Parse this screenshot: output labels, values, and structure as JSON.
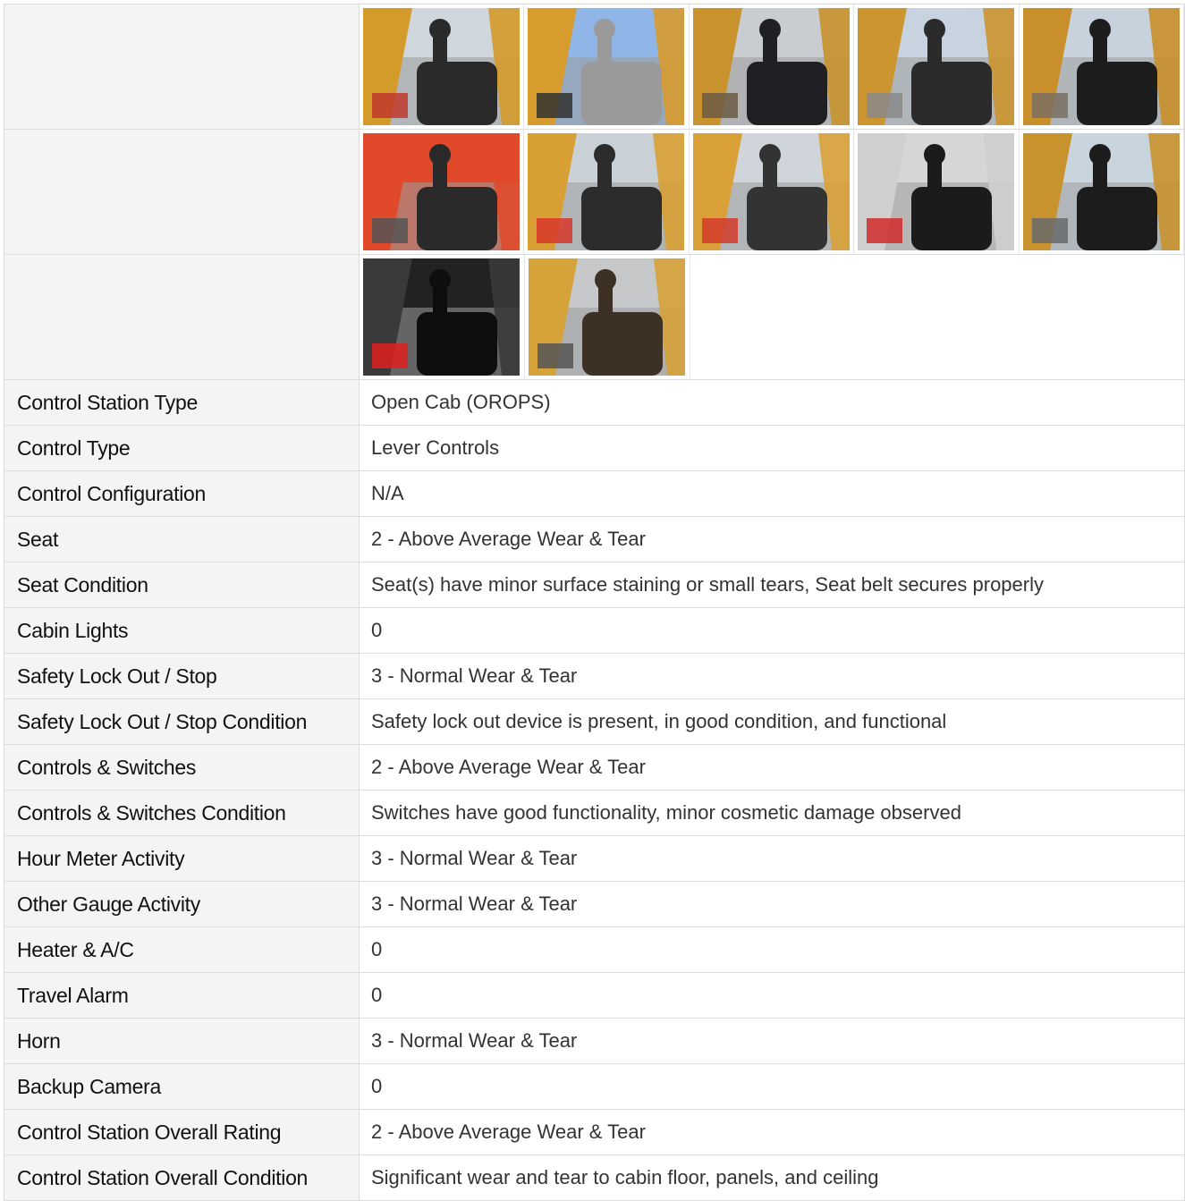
{
  "photos": [
    [
      {
        "name": "joystick-dash",
        "sky": "#cfd6dc",
        "body": "#d49a2a",
        "dark": "#2a2a2a",
        "accent": "#c0392b"
      },
      {
        "name": "cab-roof",
        "sky": "#8fb6e6",
        "body": "#d79b2e",
        "dark": "#9a9a9a",
        "accent": "#333333"
      },
      {
        "name": "seat-back",
        "sky": "#c9ccd0",
        "body": "#c9922c",
        "dark": "#1f1f24",
        "accent": "#6b5a44"
      },
      {
        "name": "seat-front",
        "sky": "#c7d3de",
        "body": "#cc9530",
        "dark": "#2b2b2b",
        "accent": "#8a8a8a"
      },
      {
        "name": "joystick-side",
        "sky": "#c8d2dc",
        "body": "#c98f2a",
        "dark": "#1d1d1d",
        "accent": "#7a6f60"
      }
    ],
    [
      {
        "name": "seat-cushion",
        "sky": "#e04a2a",
        "body": "#e04a2a",
        "dark": "#2a2a2a",
        "accent": "#555555"
      },
      {
        "name": "operator-area",
        "sky": "#c9d0d6",
        "body": "#d8a034",
        "dark": "#2c2c2c",
        "accent": "#d8372a"
      },
      {
        "name": "cab-side",
        "sky": "#cfd5da",
        "body": "#d9a137",
        "dark": "#333333",
        "accent": "#d33a2c"
      },
      {
        "name": "lever-closeup",
        "sky": "#d6d6d6",
        "body": "#cfcfcf",
        "dark": "#1b1b1b",
        "accent": "#d22a2a"
      },
      {
        "name": "joystick-rear",
        "sky": "#c9d5dd",
        "body": "#c8922d",
        "dark": "#1c1c1c",
        "accent": "#6a6a6a"
      }
    ],
    [
      {
        "name": "gauge-panel",
        "sky": "#222222",
        "body": "#3a3a3a",
        "dark": "#0e0e0e",
        "accent": "#e02020"
      },
      {
        "name": "panel-damage",
        "sky": "#c6c8ca",
        "body": "#d6a23a",
        "dark": "#3d3025",
        "accent": "#555555"
      }
    ]
  ],
  "rows": [
    {
      "label": "Control Station Type",
      "value": "Open Cab (OROPS)"
    },
    {
      "label": "Control Type",
      "value": "Lever Controls"
    },
    {
      "label": "Control Configuration",
      "value": "N/A"
    },
    {
      "label": "Seat",
      "value": "2 - Above Average Wear & Tear"
    },
    {
      "label": "Seat Condition",
      "value": "Seat(s) have minor surface staining or small tears, Seat belt secures properly"
    },
    {
      "label": "Cabin Lights",
      "value": "0"
    },
    {
      "label": "Safety Lock Out / Stop",
      "value": "3 - Normal Wear & Tear"
    },
    {
      "label": "Safety Lock Out / Stop Condition",
      "value": "Safety lock out device is present, in good condition, and functional"
    },
    {
      "label": "Controls & Switches",
      "value": "2 - Above Average Wear & Tear"
    },
    {
      "label": "Controls & Switches Condition",
      "value": "Switches have good functionality, minor cosmetic damage observed"
    },
    {
      "label": "Hour Meter Activity",
      "value": "3 - Normal Wear & Tear"
    },
    {
      "label": "Other Gauge Activity",
      "value": "3 - Normal Wear & Tear"
    },
    {
      "label": "Heater & A/C",
      "value": "0"
    },
    {
      "label": "Travel Alarm",
      "value": "0"
    },
    {
      "label": "Horn",
      "value": "3 - Normal Wear & Tear"
    },
    {
      "label": "Backup Camera",
      "value": "0"
    },
    {
      "label": "Control Station Overall Rating",
      "value": "2 - Above Average Wear & Tear"
    },
    {
      "label": "Control Station Overall Condition",
      "value": "Significant wear and tear to cabin floor, panels, and ceiling"
    }
  ]
}
